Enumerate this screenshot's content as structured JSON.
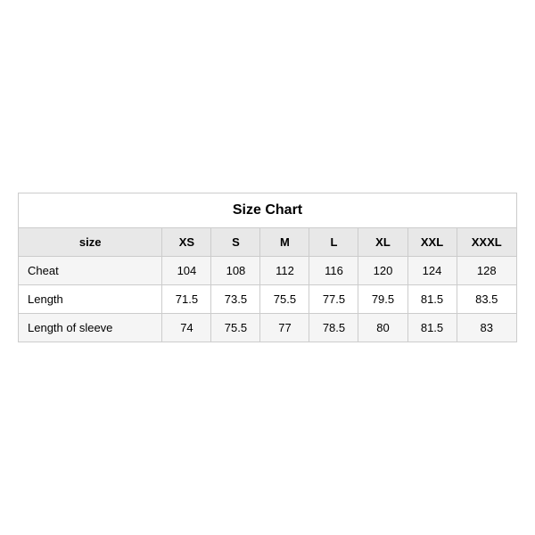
{
  "table": {
    "title": "Size Chart",
    "headers": [
      "size",
      "XS",
      "S",
      "M",
      "L",
      "XL",
      "XXL",
      "XXXL"
    ],
    "rows": [
      {
        "label": "Cheat",
        "values": [
          "104",
          "108",
          "112",
          "116",
          "120",
          "124",
          "128"
        ],
        "style": "even"
      },
      {
        "label": "Length",
        "values": [
          "71.5",
          "73.5",
          "75.5",
          "77.5",
          "79.5",
          "81.5",
          "83.5"
        ],
        "style": "odd"
      },
      {
        "label": "Length of sleeve",
        "values": [
          "74",
          "75.5",
          "77",
          "78.5",
          "80",
          "81.5",
          "83"
        ],
        "style": "even"
      }
    ]
  }
}
